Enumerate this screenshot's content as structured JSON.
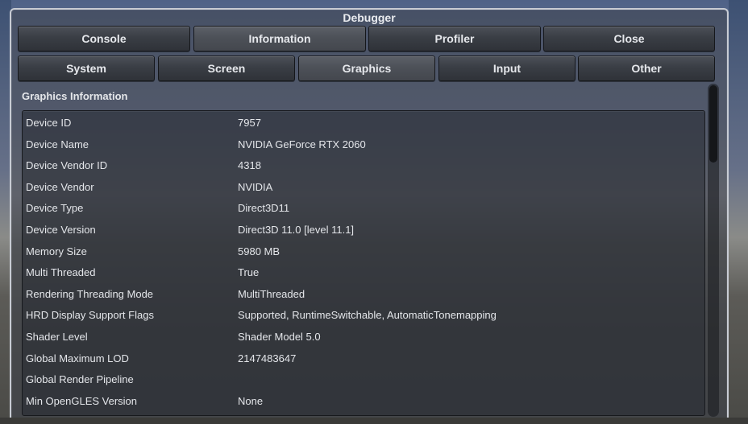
{
  "window": {
    "title": "Debugger"
  },
  "top_tabs": [
    "Console",
    "Information",
    "Profiler",
    "Close"
  ],
  "top_tabs_active": "Information",
  "sub_tabs": [
    "System",
    "Screen",
    "Graphics",
    "Input",
    "Other"
  ],
  "sub_tabs_active": "Graphics",
  "section": {
    "title": "Graphics Information"
  },
  "rows": [
    {
      "key": "Device ID",
      "value": "7957"
    },
    {
      "key": "Device Name",
      "value": "NVIDIA GeForce RTX 2060"
    },
    {
      "key": "Device Vendor ID",
      "value": "4318"
    },
    {
      "key": "Device Vendor",
      "value": "NVIDIA"
    },
    {
      "key": "Device Type",
      "value": "Direct3D11"
    },
    {
      "key": "Device Version",
      "value": "Direct3D 11.0 [level 11.1]"
    },
    {
      "key": "Memory Size",
      "value": "5980 MB"
    },
    {
      "key": "Multi Threaded",
      "value": "True"
    },
    {
      "key": "Rendering Threading Mode",
      "value": "MultiThreaded"
    },
    {
      "key": "HRD Display Support Flags",
      "value": "Supported, RuntimeSwitchable, AutomaticTonemapping"
    },
    {
      "key": "Shader Level",
      "value": "Shader Model 5.0"
    },
    {
      "key": "Global Maximum LOD",
      "value": "2147483647"
    },
    {
      "key": "Global Render Pipeline",
      "value": ""
    },
    {
      "key": "Min OpenGLES Version",
      "value": "None"
    }
  ]
}
